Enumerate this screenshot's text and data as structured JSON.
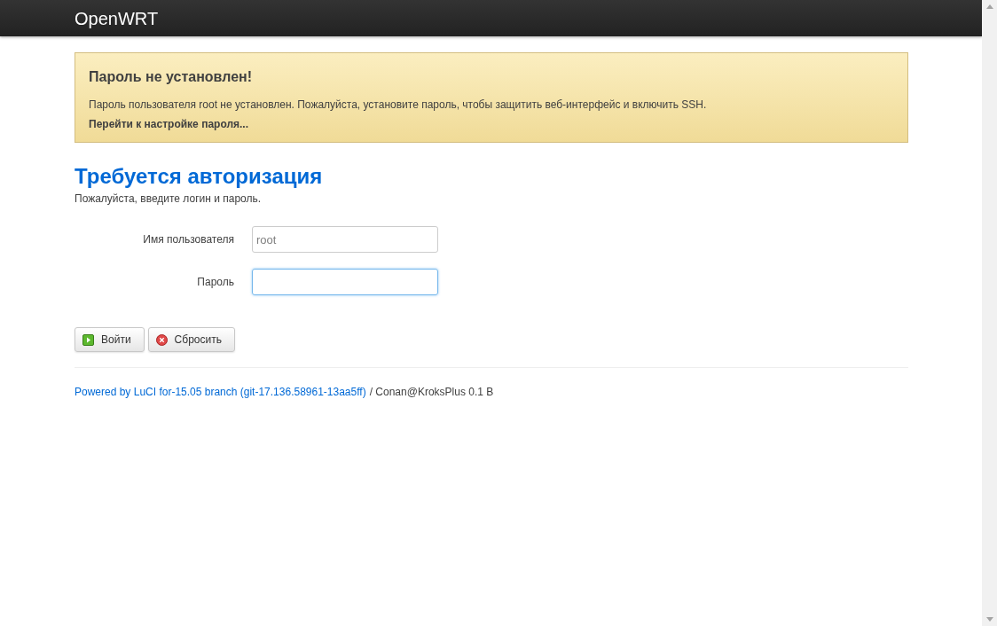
{
  "header": {
    "brand": "OpenWRT"
  },
  "alert": {
    "title": "Пароль не установлен!",
    "text": "Пароль пользователя root не установлен. Пожалуйста, установите пароль, чтобы защитить веб-интерфейс и включить SSH.",
    "link": "Перейти к настройке пароля..."
  },
  "login": {
    "title": "Требуется авторизация",
    "subtitle": "Пожалуйста, введите логин и пароль.",
    "fields": [
      {
        "label": "Имя пользователя",
        "value": "root",
        "focused": false
      },
      {
        "label": "Пароль",
        "focused": true
      }
    ],
    "buttons": [
      {
        "label": "Войти",
        "kind": "submit"
      },
      {
        "label": "Сбросить",
        "kind": "reset"
      }
    ]
  },
  "footer": {
    "link": "Powered by LuCI for-15.05 branch (git-17.136.58961-13aa5ff)",
    "text": "/ Conan@KroksPlus 0.1 B"
  }
}
